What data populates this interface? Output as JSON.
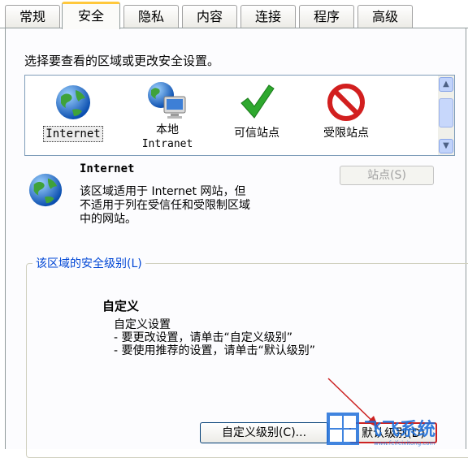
{
  "tabs": [
    {
      "label": "常规",
      "active": false
    },
    {
      "label": "安全",
      "active": true
    },
    {
      "label": "隐私",
      "active": false
    },
    {
      "label": "内容",
      "active": false
    },
    {
      "label": "连接",
      "active": false
    },
    {
      "label": "程序",
      "active": false
    },
    {
      "label": "高级",
      "active": false
    }
  ],
  "prompt": "选择要查看的区域或更改安全设置。",
  "zones": [
    {
      "line1": "Internet",
      "line2": "",
      "icon": "globe-icon",
      "selected": true
    },
    {
      "line1": "本地",
      "line2": "Intranet",
      "icon": "computer-globe-icon",
      "selected": false
    },
    {
      "line1": "可信站点",
      "line2": "",
      "icon": "checkmark-icon",
      "selected": false
    },
    {
      "line1": "受限站点",
      "line2": "",
      "icon": "no-entry-icon",
      "selected": false
    }
  ],
  "info": {
    "title": "Internet",
    "line1": "该区域适用于 Internet 网站，但",
    "line2": "不适用于列在受信任和受限制区域",
    "line3": "中的网站。",
    "sites_button": "站点(S)"
  },
  "security_level": {
    "group_label": "该区域的安全级别(L)",
    "title": "自定义",
    "line1": "自定义设置",
    "line2": "- 要更改设置，请单击“自定义级别”",
    "line3": "- 要使用推荐的设置，请单击“默认级别”"
  },
  "buttons": {
    "custom_level": "自定义级别(C)...",
    "default_level": "默认级别(D)"
  },
  "colors": {
    "accent": "#0046d5",
    "arrow": "#cc2222"
  }
}
